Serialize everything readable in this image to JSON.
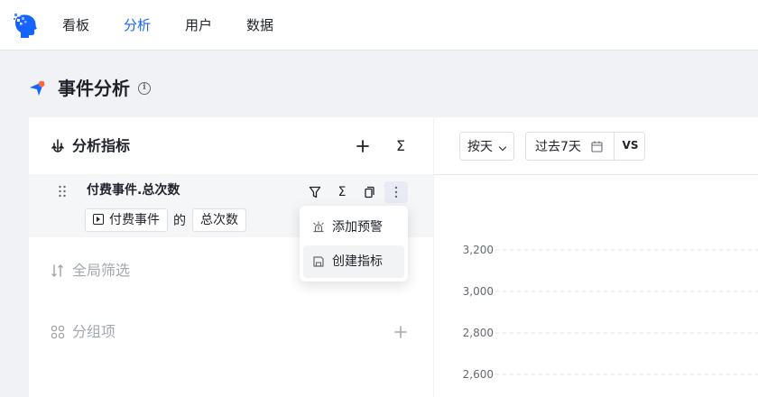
{
  "nav": {
    "items": [
      "看板",
      "分析",
      "用户",
      "数据"
    ],
    "active": "分析"
  },
  "page": {
    "title": "事件分析"
  },
  "metrics_section": {
    "title": "分析指标"
  },
  "metric": {
    "title": "付费事件.总次数",
    "event_tag": "付费事件",
    "connector": "的",
    "measure_tag": "总次数"
  },
  "dropdown": {
    "items": [
      "添加预警",
      "创建指标"
    ],
    "hovered": "创建指标"
  },
  "filter_section": {
    "title": "全局筛选"
  },
  "group_section": {
    "title": "分组项"
  },
  "toolbar": {
    "granularity": "按天",
    "date_range": "过去7天",
    "compare": "VS"
  },
  "chart_data": {
    "type": "line",
    "y_ticks": [
      3200,
      3000,
      2800,
      2600
    ],
    "y_tick_labels": [
      "3,200",
      "3,000",
      "2,800",
      "2,600"
    ],
    "grid": "dashed-horizontal"
  },
  "colors": {
    "accent": "#1664ff",
    "text": "#1f2329",
    "muted": "#a3a8b0",
    "page_bg": "#f1f2f5"
  }
}
